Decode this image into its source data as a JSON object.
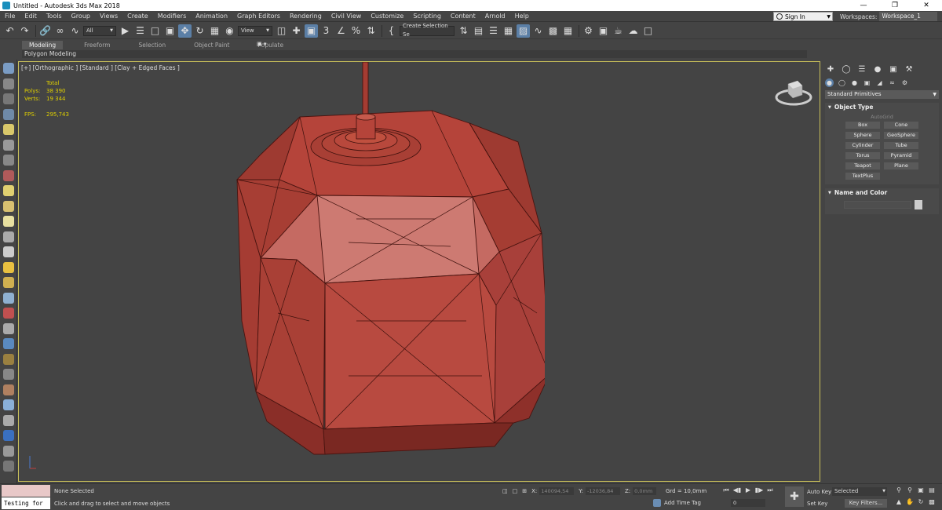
{
  "window": {
    "title": "Untitled - Autodesk 3ds Max 2018"
  },
  "menu": [
    "File",
    "Edit",
    "Tools",
    "Group",
    "Views",
    "Create",
    "Modifiers",
    "Animation",
    "Graph Editors",
    "Rendering",
    "Civil View",
    "Customize",
    "Scripting",
    "Content",
    "Arnold",
    "Help"
  ],
  "account": {
    "signin_label": "Sign In",
    "workspaces_label": "Workspaces:",
    "workspace_value": "Workspace_1"
  },
  "toolbar": {
    "filter_value": "All",
    "refcoord_value": "View",
    "selection_set_value": "Create Selection Se"
  },
  "ribbon": {
    "tabs": [
      "Modeling",
      "Freeform",
      "Selection",
      "Object Paint",
      "Populate"
    ],
    "active_tab": "Modeling",
    "sub_label": "Polygon Modeling"
  },
  "viewport": {
    "label": "[+] [Orthographic ] [Standard ] [Clay + Edged Faces ]",
    "stats": {
      "total_label": "Total",
      "polys_label": "Polys:",
      "polys_value": "38 390",
      "verts_label": "Verts:",
      "verts_value": "19 344",
      "fps_label": "FPS:",
      "fps_value": "295,743"
    },
    "mesh_color": "#b5443a"
  },
  "command_panel": {
    "category": "Standard Primitives",
    "object_type_title": "Object Type",
    "autogrid_label": "AutoGrid",
    "object_buttons": [
      "Box",
      "Cone",
      "Sphere",
      "GeoSphere",
      "Cylinder",
      "Tube",
      "Torus",
      "Pyramid",
      "Teapot",
      "Plane",
      "TextPlus"
    ],
    "name_color_title": "Name and Color"
  },
  "status": {
    "script_output": "Testing for",
    "selection": "None Selected",
    "prompt": "Click and drag to select and move objects",
    "x_label": "X:",
    "x_value": "140094,54",
    "y_label": "Y:",
    "y_value": "-12036,84",
    "z_label": "Z:",
    "z_value": "0,0mm",
    "grid": "Grd = 10,0mm",
    "add_time_tag": "Add Time Tag",
    "frame_value": "0",
    "auto_key": "Auto Key",
    "set_key": "Set Key",
    "selected_value": "Selected",
    "key_filters": "Key Filters..."
  }
}
